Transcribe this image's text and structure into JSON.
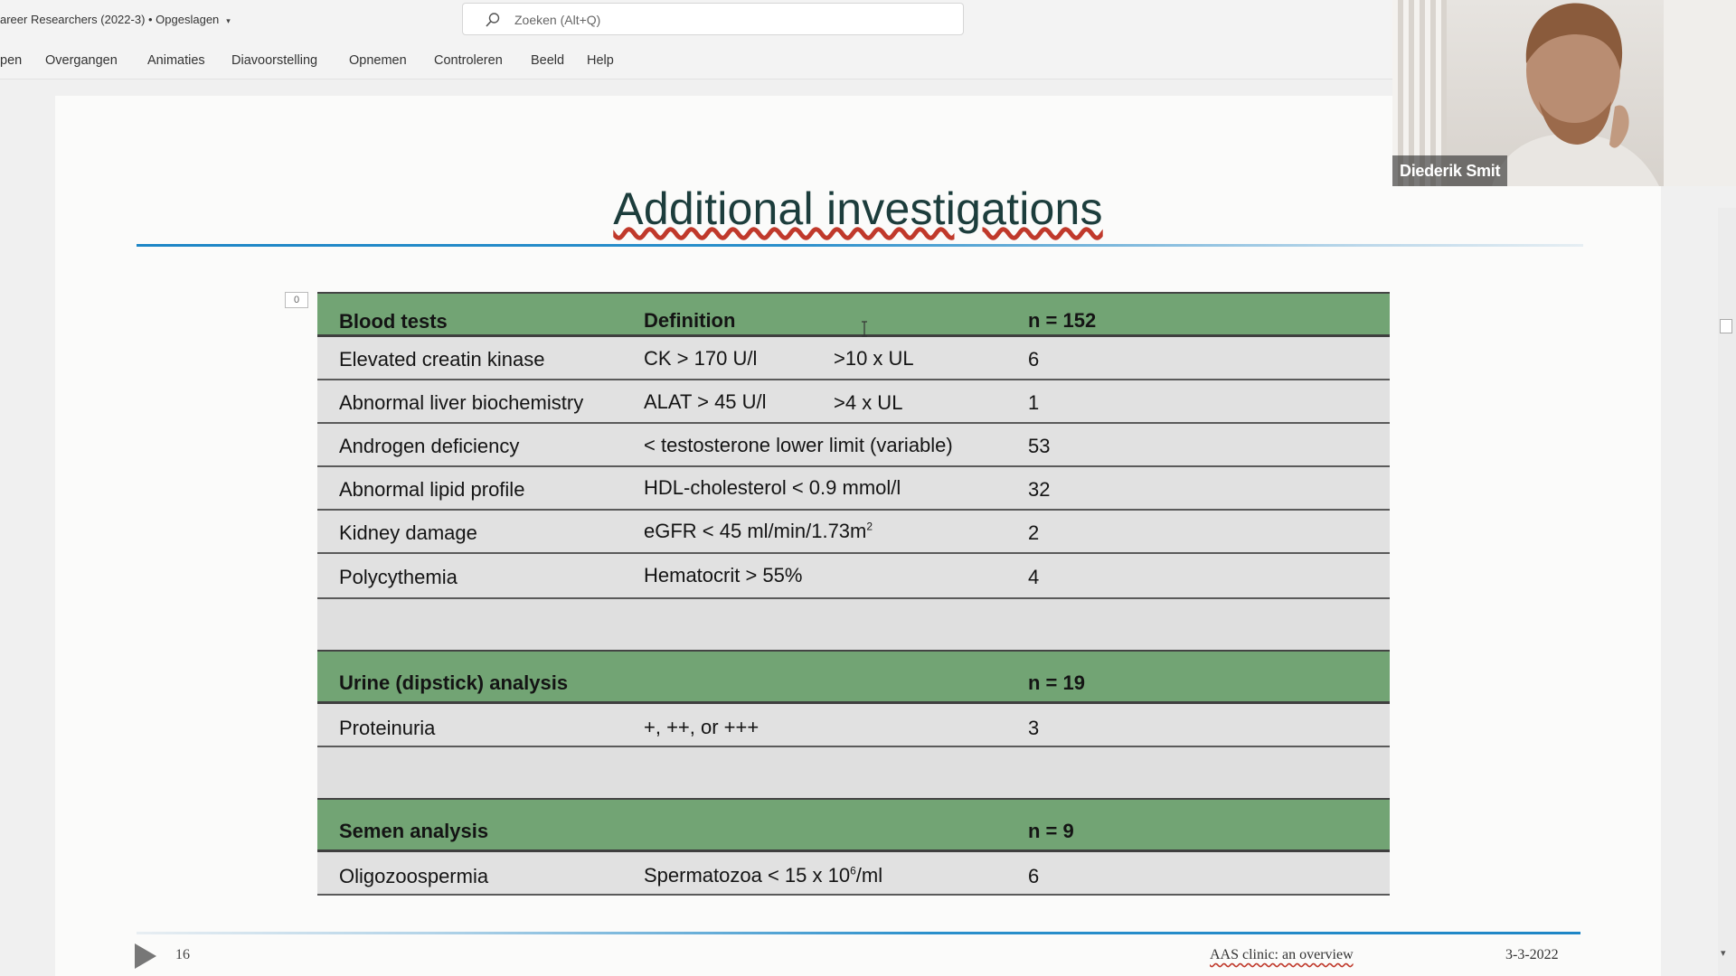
{
  "titlebar": {
    "doc_title": "areer Researchers (2022-3) • Opgeslagen",
    "search_placeholder": "Zoeken (Alt+Q)"
  },
  "ribbon": {
    "tabs": [
      "pen",
      "Overgangen",
      "Animaties",
      "Diavoorstelling",
      "Opnemen",
      "Controleren",
      "Beeld",
      "Help"
    ]
  },
  "slide": {
    "title": "Additional investigations",
    "counter_box": "0",
    "blood": {
      "header": [
        "Blood tests",
        "Definition",
        "n = 152"
      ],
      "rows": [
        {
          "name": "Elevated creatin kinase",
          "def": "CK > 170 U/l",
          "extra": ">10 x UL",
          "n": "6"
        },
        {
          "name": "Abnormal liver biochemistry",
          "def": "ALAT > 45 U/l",
          "extra": ">4 x UL",
          "n": "1"
        },
        {
          "name": "Androgen deficiency",
          "def": "< testosterone lower limit (variable)",
          "extra": "",
          "n": "53"
        },
        {
          "name": "Abnormal lipid profile",
          "def": "HDL-cholesterol < 0.9 mmol/l",
          "extra": "",
          "n": "32"
        },
        {
          "name": "Kidney damage",
          "def": "eGFR < 45 ml/min/1.73m",
          "def_sup": "2",
          "extra": "",
          "n": "2"
        },
        {
          "name": "Polycythemia",
          "def": "Hematocrit > 55%",
          "extra": "",
          "n": "4"
        }
      ]
    },
    "urine": {
      "header": [
        "Urine (dipstick) analysis",
        "n = 19"
      ],
      "rows": [
        {
          "name": "Proteinuria",
          "def": "+, ++, or +++",
          "n": "3"
        }
      ]
    },
    "semen": {
      "header": [
        "Semen analysis",
        "n = 9"
      ],
      "rows": [
        {
          "name": "Oligozoospermia",
          "def": "Spermatozoa < 15 x 10",
          "def_sup": "6",
          "def_tail": "/ml",
          "n": "6"
        }
      ]
    },
    "footer": {
      "slide_number": "16",
      "center_text": "AAS clinic: an overview",
      "date": "3-3-2022"
    }
  },
  "webcam": {
    "participant_name": "Diederik Smit"
  },
  "colors": {
    "header_green": "#72a474",
    "accent_blue": "#1e86c6"
  }
}
